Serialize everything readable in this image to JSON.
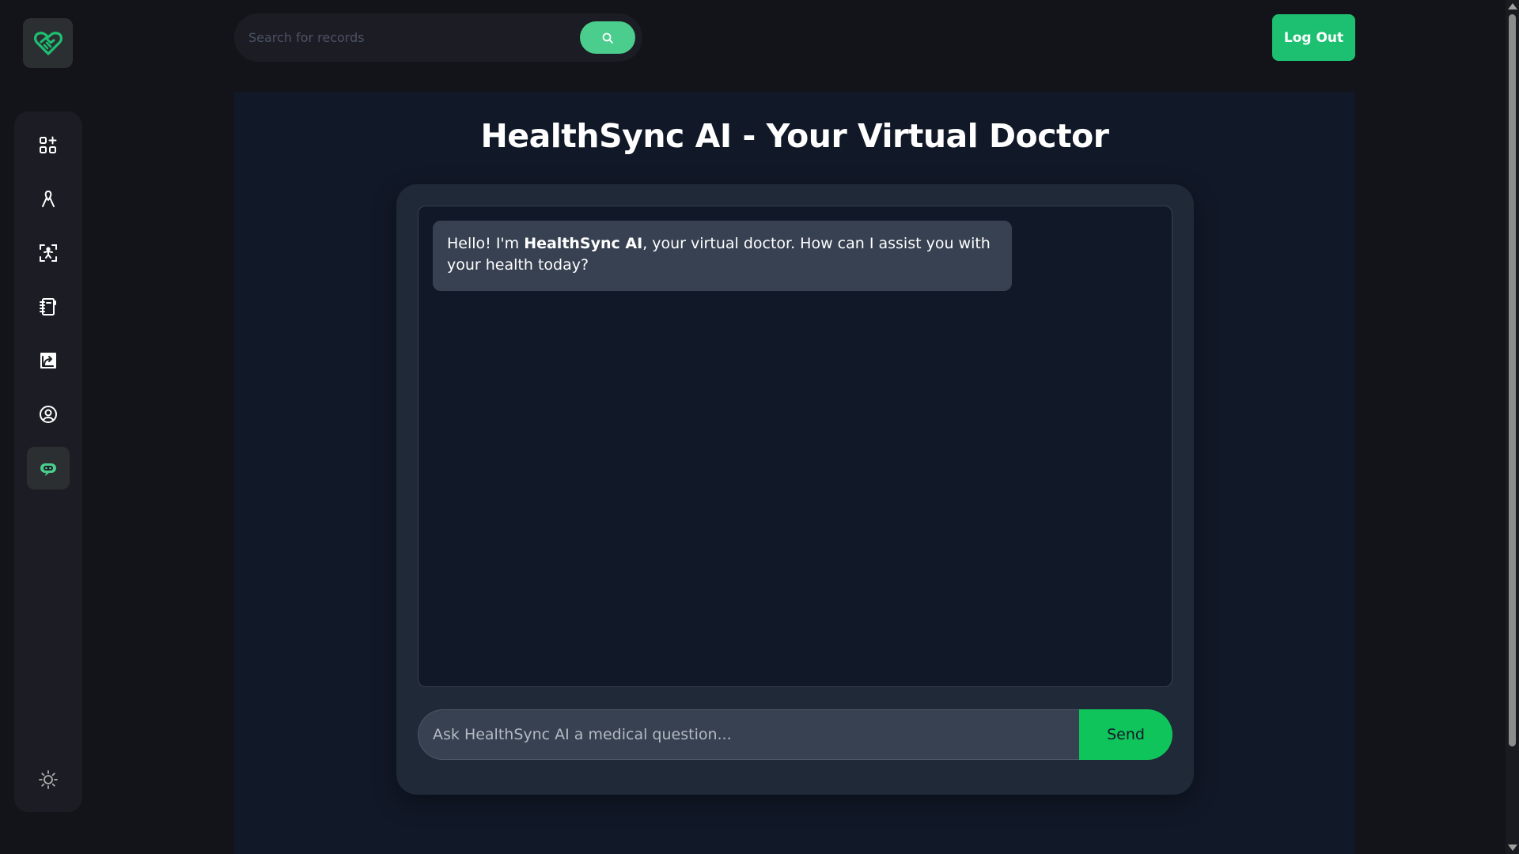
{
  "header": {
    "search_placeholder": "Search for records",
    "search_icon": "search-icon",
    "logout_label": "Log Out"
  },
  "logo": {
    "icon": "heart-handshake-logo-icon"
  },
  "sidebar": {
    "items": [
      {
        "name": "dashboard",
        "icon": "dashboard-grid-plus-icon",
        "active": false
      },
      {
        "name": "ribbon",
        "icon": "awareness-ribbon-icon",
        "active": false
      },
      {
        "name": "scan",
        "icon": "body-scan-icon",
        "active": false
      },
      {
        "name": "records",
        "icon": "notebook-icon",
        "active": false
      },
      {
        "name": "share",
        "icon": "share-icon",
        "active": false
      },
      {
        "name": "profile",
        "icon": "user-circle-icon",
        "active": false
      },
      {
        "name": "ai-chat",
        "icon": "robot-chat-icon",
        "active": true
      }
    ],
    "theme_toggle_icon": "sun-icon"
  },
  "main": {
    "title": "HealthSync AI - Your Virtual Doctor",
    "messages": [
      {
        "sender": "assistant",
        "text_before": "Hello! I'm ",
        "text_bold": "HealthSync AI",
        "text_after": ", your virtual doctor. How can I assist you with your health today?"
      }
    ],
    "input_placeholder": "Ask HealthSync AI a medical question...",
    "send_label": "Send"
  },
  "colors": {
    "accent": "#1dc071",
    "accent_light": "#4acd8d",
    "send": "#10c45c",
    "page_bg": "#131419",
    "panel_bg": "#111827",
    "card_bg": "#1f2937",
    "bubble_bg": "#374151"
  }
}
